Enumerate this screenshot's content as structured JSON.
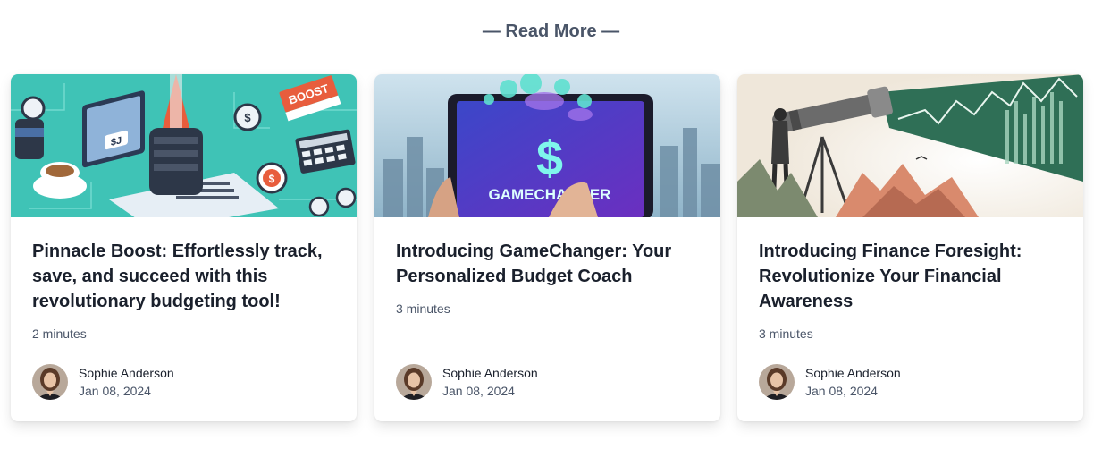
{
  "heading": "— Read More —",
  "cards": [
    {
      "image_icon": "budget-app-illustration",
      "image_text_1": "BOOST",
      "image_text_2": "$",
      "title": "Pinnacle Boost: Effortlessly track, save, and succeed with this revolutionary budgeting tool!",
      "read_time": "2 minutes",
      "author": "Sophie Anderson",
      "date": "Jan 08, 2024"
    },
    {
      "image_icon": "tablet-dollar-illustration",
      "image_text_1": "GAMECHANGER",
      "image_text_2": "$",
      "title": "Introducing GameChanger: Your Personalized Budget Coach",
      "read_time": "3 minutes",
      "author": "Sophie Anderson",
      "date": "Jan 08, 2024"
    },
    {
      "image_icon": "telescope-chart-illustration",
      "title": "Introducing Finance Foresight: Revolutionize Your Financial Awareness",
      "read_time": "3 minutes",
      "author": "Sophie Anderson",
      "date": "Jan 08, 2024"
    }
  ],
  "colors": {
    "heading": "#4a5568",
    "title": "#1a202c",
    "meta": "#4a5568"
  }
}
